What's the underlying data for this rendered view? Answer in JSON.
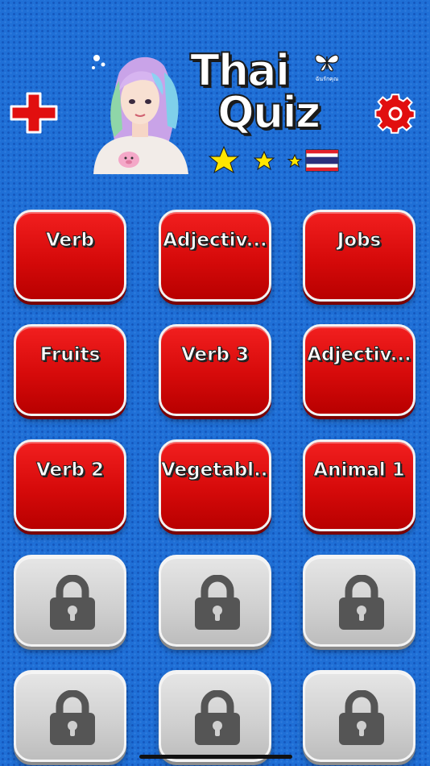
{
  "header": {
    "add_icon": "plus-icon",
    "settings_icon": "gear-icon",
    "logo": {
      "line1": "Thai",
      "line2": "Quiz",
      "brand_sub": "ฉันรักคุณ"
    }
  },
  "colors": {
    "background": "#1f6fd6",
    "tile_unlocked": "#d60a0a",
    "tile_locked": "#cfcfcf",
    "plus": "#e10f0f",
    "gear": "#e10f0f"
  },
  "categories": [
    {
      "label": "Verb",
      "locked": false
    },
    {
      "label": "Adjectiv...",
      "locked": false
    },
    {
      "label": "Jobs",
      "locked": false
    },
    {
      "label": "Fruits",
      "locked": false
    },
    {
      "label": "Verb 3",
      "locked": false
    },
    {
      "label": "Adjectiv...",
      "locked": false
    },
    {
      "label": "Verb 2",
      "locked": false
    },
    {
      "label": "Vegetabl...",
      "locked": false
    },
    {
      "label": "Animal 1",
      "locked": false
    },
    {
      "label": "",
      "locked": true
    },
    {
      "label": "",
      "locked": true
    },
    {
      "label": "",
      "locked": true
    },
    {
      "label": "",
      "locked": true
    },
    {
      "label": "",
      "locked": true
    },
    {
      "label": "",
      "locked": true
    }
  ]
}
